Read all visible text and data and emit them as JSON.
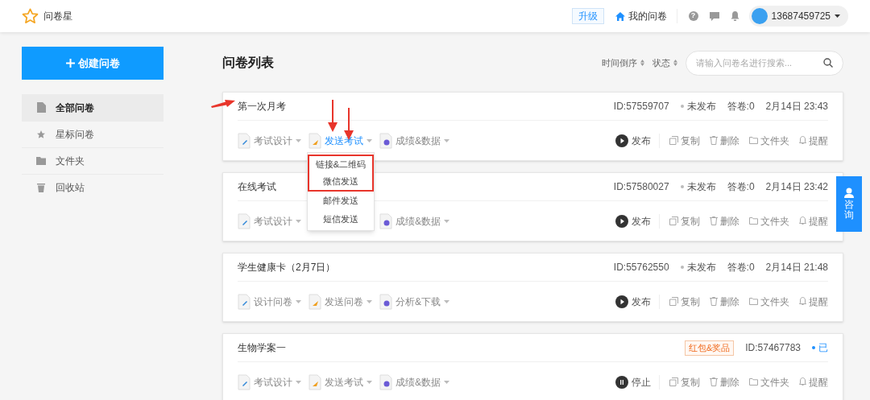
{
  "header": {
    "logo_text": "问卷星",
    "upgrade": "升级",
    "my_surveys": "我的问卷",
    "help": "?",
    "account": "13687459725"
  },
  "sidebar": {
    "create_button": "创建问卷",
    "items": [
      {
        "label": "全部问卷",
        "kind": "file",
        "selected": true
      },
      {
        "label": "星标问卷",
        "kind": "star",
        "selected": false
      },
      {
        "label": "文件夹",
        "kind": "folder",
        "selected": false
      },
      {
        "label": "回收站",
        "kind": "trash",
        "selected": false
      }
    ]
  },
  "main": {
    "title": "问卷列表",
    "sort": "时间倒序",
    "status_filter": "状态",
    "search": {
      "placeholder": "请输入问卷名进行搜索..."
    }
  },
  "cards": [
    {
      "title": "第一次月考",
      "id": "ID:57559707",
      "status": "未发布",
      "color": "#bbbbbb",
      "answers": "答卷:0",
      "time": "2月14日 23:43",
      "actions": [
        {
          "kind": "design",
          "label": "考试设计",
          "active": false
        },
        {
          "kind": "send",
          "label": "发送考试",
          "active": true
        },
        {
          "kind": "data",
          "label": "成绩&数据",
          "active": false
        }
      ],
      "publish": {
        "kind": "play",
        "label": "发布"
      },
      "tools": [
        "复制",
        "删除",
        "文件夹",
        "提醒"
      ],
      "dropdown": [
        {
          "label": "链接&二维码",
          "highlighted": true
        },
        {
          "label": "微信发送",
          "highlighted": true
        },
        {
          "label": "邮件发送",
          "highlighted": false
        },
        {
          "label": "短信发送",
          "highlighted": false
        }
      ]
    },
    {
      "title": "在线考试",
      "id": "ID:57580027",
      "status": "未发布",
      "color": "#bbbbbb",
      "answers": "答卷:0",
      "time": "2月14日 23:42",
      "actions": [
        {
          "kind": "design",
          "label": "考试设计",
          "active": false
        },
        {
          "kind": "data",
          "label": "成绩&数据",
          "active": false
        }
      ],
      "publish": {
        "kind": "play",
        "label": "发布"
      },
      "tools": [
        "复制",
        "删除",
        "文件夹",
        "提醒"
      ]
    },
    {
      "title": "学生健康卡（2月7日）",
      "id": "ID:55762550",
      "status": "未发布",
      "color": "#bbbbbb",
      "answers": "答卷:0",
      "time": "2月14日 21:48",
      "actions": [
        {
          "kind": "design",
          "label": "设计问卷",
          "active": false
        },
        {
          "kind": "send",
          "label": "发送问卷",
          "active": false
        },
        {
          "kind": "data",
          "label": "分析&下载",
          "active": false
        }
      ],
      "publish": {
        "kind": "play",
        "label": "发布"
      },
      "tools": [
        "复制",
        "删除",
        "文件夹",
        "提醒"
      ]
    },
    {
      "title": "生物学案一",
      "badge": "红包&奖品",
      "id": "ID:57467783",
      "status": "已",
      "color": "#1e90ff",
      "actions": [
        {
          "kind": "design",
          "label": "考试设计",
          "active": false
        },
        {
          "kind": "send",
          "label": "发送考试",
          "active": false
        },
        {
          "kind": "data",
          "label": "成绩&数据",
          "active": false
        }
      ],
      "publish": {
        "kind": "pause",
        "label": "停止"
      },
      "tools": [
        "复制",
        "删除",
        "文件夹",
        "提醒"
      ]
    }
  ],
  "consult": "咨询"
}
